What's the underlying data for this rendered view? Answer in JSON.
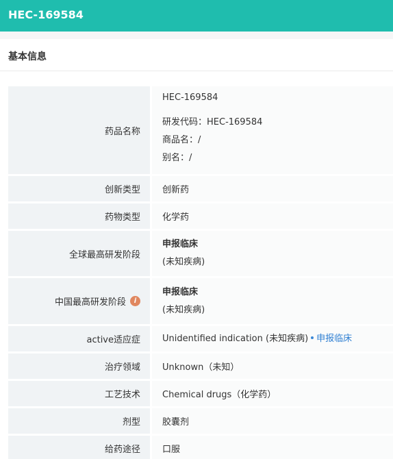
{
  "header": {
    "title": "HEC-169584"
  },
  "section": {
    "title": "基本信息"
  },
  "rows": {
    "name": {
      "key": "药品名称",
      "line1": "HEC-169584",
      "line2": "研发代码：HEC-169584",
      "line3": "商品名：/",
      "line4": "别名：/"
    },
    "innovation": {
      "key": "创新类型",
      "value": "创新药"
    },
    "drug_type": {
      "key": "药物类型",
      "value": "化学药"
    },
    "global_stage": {
      "key": "全球最高研发阶段",
      "value": "申报临床",
      "note": "(未知疾病)"
    },
    "china_stage": {
      "key": "中国最高研发阶段",
      "icon": "info-icon",
      "icon_text": "i",
      "value": "申报临床",
      "note": "(未知疾病)"
    },
    "indication": {
      "key": "active适应症",
      "value": "Unidentified indication (未知疾病)",
      "link": "申报临床",
      "link_color": "#2f7fd2"
    },
    "therapy": {
      "key": "治疗领域",
      "value": "Unknown（未知）"
    },
    "process": {
      "key": "工艺技术",
      "value": "Chemical drugs（化学药）"
    },
    "dosage": {
      "key": "剂型",
      "value": "胶囊剂"
    },
    "route": {
      "key": "给药途径",
      "value": "口服"
    }
  },
  "colors": {
    "brand": "#1fbdae",
    "link": "#2f7fd2",
    "info_icon": "#e0875f"
  }
}
